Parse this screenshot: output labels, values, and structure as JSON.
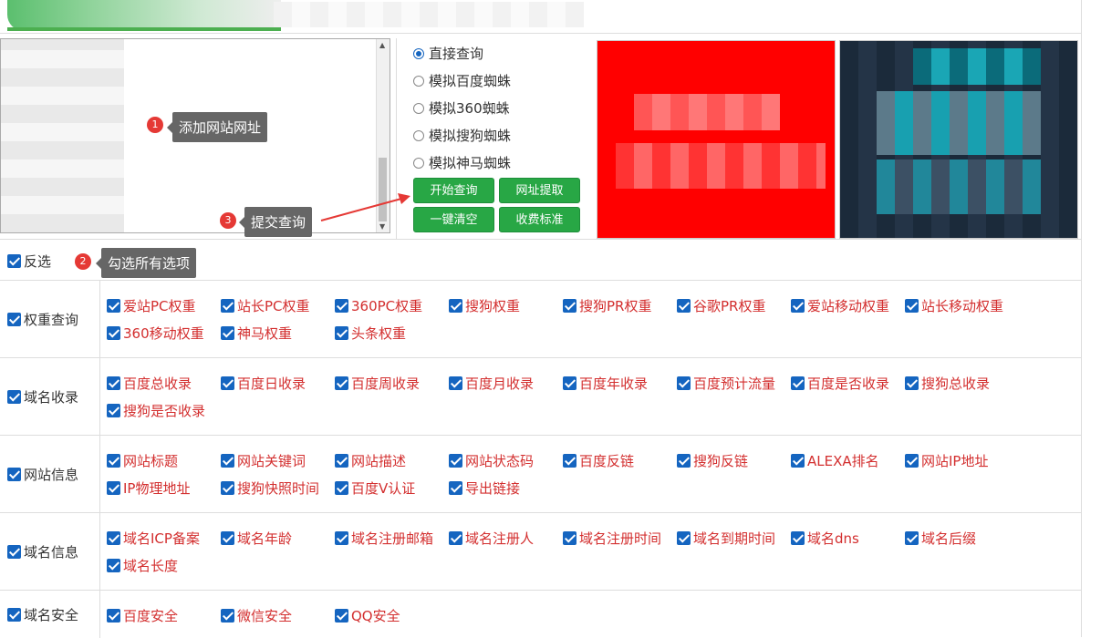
{
  "input": {
    "tip_add": "添加网站网址",
    "badge1": "1"
  },
  "submit_tip": {
    "text": "提交查询",
    "badge": "3"
  },
  "reverse": {
    "label": "反选",
    "tip": "勾选所有选项",
    "badge": "2"
  },
  "modes": [
    {
      "label": "直接查询",
      "selected": true
    },
    {
      "label": "模拟百度蜘蛛",
      "selected": false
    },
    {
      "label": "模拟360蜘蛛",
      "selected": false
    },
    {
      "label": "模拟搜狗蜘蛛",
      "selected": false
    },
    {
      "label": "模拟神马蜘蛛",
      "selected": false
    }
  ],
  "buttons": [
    "开始查询",
    "网址提取",
    "一键清空",
    "收费标准"
  ],
  "groups": [
    {
      "label": "权重查询",
      "items": [
        "爱站PC权重",
        "站长PC权重",
        "360PC权重",
        "搜狗权重",
        "搜狗PR权重",
        "谷歌PR权重",
        "爱站移动权重",
        "站长移动权重",
        "360移动权重",
        "神马权重",
        "头条权重"
      ]
    },
    {
      "label": "域名收录",
      "items": [
        "百度总收录",
        "百度日收录",
        "百度周收录",
        "百度月收录",
        "百度年收录",
        "百度预计流量",
        "百度是否收录",
        "搜狗总收录",
        "搜狗是否收录"
      ]
    },
    {
      "label": "网站信息",
      "items": [
        "网站标题",
        "网站关键词",
        "网站描述",
        "网站状态码",
        "百度反链",
        "搜狗反链",
        "ALEXA排名",
        "网站IP地址",
        "IP物理地址",
        "搜狗快照时间",
        "百度V认证",
        "导出链接"
      ]
    },
    {
      "label": "域名信息",
      "items": [
        "域名ICP备案",
        "域名年龄",
        "域名注册邮箱",
        "域名注册人",
        "域名注册时间",
        "域名到期时间",
        "域名dns",
        "域名后缀",
        "域名长度"
      ]
    },
    {
      "label": "域名安全",
      "items": [
        "百度安全",
        "微信安全",
        "QQ安全"
      ]
    }
  ],
  "colors": {
    "accent": "#28a745",
    "option_text": "#d32f2f",
    "checkbox": "#1565c0",
    "arrow": "#e53935"
  }
}
